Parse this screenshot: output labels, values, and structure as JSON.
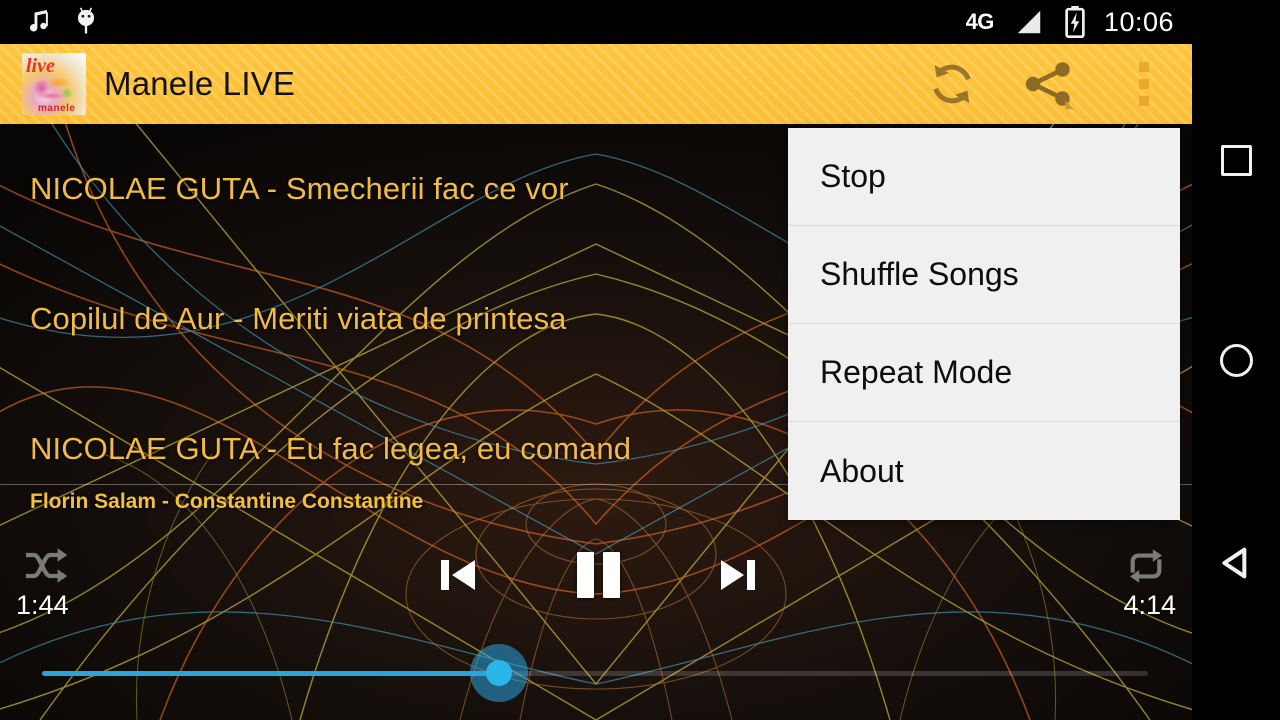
{
  "statusbar": {
    "notification_icons": [
      "music-note-icon",
      "android-bug-icon"
    ],
    "network_label": "4G",
    "signal_icon": "signal-bars-icon",
    "battery_icon": "battery-charging-icon",
    "clock": "10:06"
  },
  "appbar": {
    "title": "Manele LIVE",
    "logo_text_primary": "live",
    "logo_text_secondary": "manele",
    "actions": [
      {
        "name": "refresh-button",
        "icon": "refresh-icon"
      },
      {
        "name": "share-button",
        "icon": "share-icon"
      },
      {
        "name": "overflow-button",
        "icon": "overflow-menu-icon"
      }
    ]
  },
  "menu": {
    "items": [
      {
        "label": "Stop"
      },
      {
        "label": "Shuffle Songs"
      },
      {
        "label": "Repeat Mode"
      },
      {
        "label": "About"
      }
    ]
  },
  "songlist": {
    "items": [
      {
        "title": "NICOLAE GUTA - Smecherii fac ce vor"
      },
      {
        "title": "Copilul de Aur - Meriti viata de printesa"
      },
      {
        "title": "NICOLAE GUTA - Eu fac legea, eu comand"
      }
    ]
  },
  "player": {
    "now_playing": "Florin Salam - Constantine Constantine",
    "time_current": "1:44",
    "time_total": "4:14",
    "progress_percent": 41,
    "shuffle_state": "off",
    "repeat_state": "off",
    "playback_state": "playing",
    "controls": {
      "shuffle": "shuffle-icon",
      "previous": "skip-previous-icon",
      "play_pause": "pause-icon",
      "next": "skip-next-icon",
      "repeat": "repeat-icon"
    }
  },
  "navbar": {
    "recents": "square-recents-icon",
    "home": "circle-home-icon",
    "back": "triangle-back-icon"
  },
  "colors": {
    "appbar": "#fcbe34",
    "song_title": "#f2bb42",
    "now_playing": "#f5c037",
    "seek_accent": "#2ba4dc",
    "menu_bg": "#f0f0f0",
    "background": "#100d0a"
  }
}
